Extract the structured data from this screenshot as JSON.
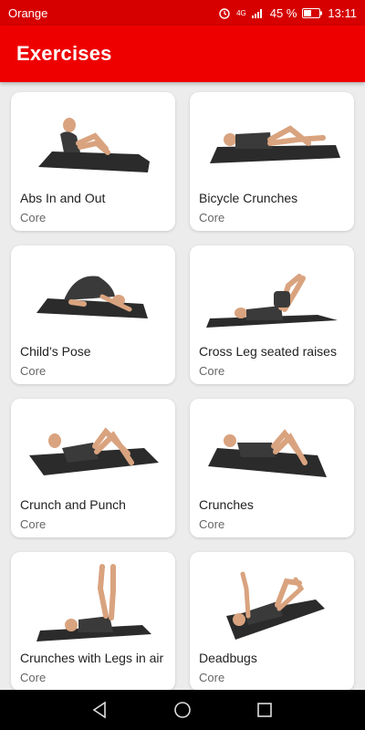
{
  "status_bar": {
    "carrier": "Orange",
    "network": "4G",
    "battery": "45 %",
    "time": "13:11"
  },
  "app_bar": {
    "title": "Exercises"
  },
  "exercises": [
    {
      "name": "Abs In and Out",
      "category": "Core"
    },
    {
      "name": "Bicycle Crunches",
      "category": "Core"
    },
    {
      "name": "Child’s Pose",
      "category": "Core"
    },
    {
      "name": "Cross Leg seated raises",
      "category": "Core"
    },
    {
      "name": "Crunch and Punch",
      "category": "Core"
    },
    {
      "name": "Crunches",
      "category": "Core"
    },
    {
      "name": "Crunches with Legs in air",
      "category": "Core"
    },
    {
      "name": "Deadbugs",
      "category": "Core"
    }
  ],
  "colors": {
    "status_bar": "#d60000",
    "app_bar": "#ee0000",
    "background": "#ececec",
    "mat": "#2b2b2b",
    "skin": "#d9a37f",
    "clothes": "#3a3a3a"
  },
  "nav_bar": {
    "back_icon": "triangle-back-icon",
    "home_icon": "circle-home-icon",
    "recents_icon": "square-recents-icon"
  }
}
